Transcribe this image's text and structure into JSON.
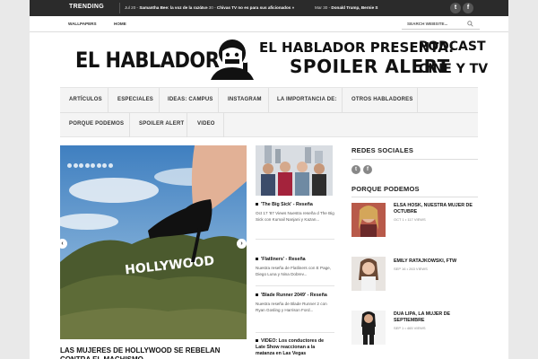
{
  "topbar": {
    "trending_label": "TRENDING",
    "items": [
      {
        "date": "Jul 20 -",
        "title": "Samantha Bee: la voz de la razón »"
      },
      {
        "date": "Jun 30 -",
        "title": "Chivas TV no es para sus aficionados »"
      },
      {
        "date": "Mar 30 -",
        "title": "Donald Trump, Bernie S"
      }
    ],
    "social": [
      {
        "icon": "twitter-icon",
        "glyph": "t"
      },
      {
        "icon": "facebook-icon",
        "glyph": "f"
      }
    ]
  },
  "subbar": {
    "links": [
      "WALLPAPERS",
      "HOME"
    ],
    "search_placeholder": "SEARCH WEBSITE..."
  },
  "logo": "EL HABLADOR",
  "banner": {
    "line1": "EL HABLADOR PRESENTA:",
    "line2": "SPOILER ALERT",
    "right1": "PODCAST",
    "right2": "CINE Y TV"
  },
  "nav": {
    "row1": [
      "ARTÍCULOS",
      "ESPECIALES",
      "IDEAS: CAMPUS",
      "INSTAGRAM",
      "LA IMPORTANCIA DE:",
      "OTROS HABLADORES"
    ],
    "row2": [
      "PORQUE PODEMOS",
      "SPOILER ALERT",
      "VIDEO"
    ]
  },
  "slider": {
    "dot_count": 8,
    "hollywood_sign": "HOLLYWOOD",
    "title": "LAS MUJERES DE HOLLYWOOD SE REBELAN CONTRA EL MACHISMO"
  },
  "middle": {
    "items": [
      {
        "title": "'The Big Sick' - Reseña",
        "excerpt": "Oct 17 '87 Views Nuestra reseña d The Big Sick con Kumail Nanjani y Kazan..."
      },
      {
        "title": "'Flatliners' - Reseña",
        "excerpt": "Nuestra reseña de Flatliners con E Page, Diego Luna y Nina Dobrev..."
      },
      {
        "title": "'Blade Runner 2049' - Reseña",
        "excerpt": "Nuestra reseña de Blade Runner 2 con Ryan Gosling y Harrison Ford..."
      },
      {
        "title": "VIDEO: Los conductores de Late Show reaccionan a la matanza en Las Vegas",
        "excerpt": ""
      }
    ]
  },
  "sidebar": {
    "social_heading": "REDES SOCIALES",
    "section_heading": "PORQUE PODEMOS",
    "posts": [
      {
        "title": "ELSA HOSK, NUESTRA MUJER DE OCTUBRE",
        "meta": "OCT 1 • 117 VIEWS"
      },
      {
        "title": "EMILY RATAJKOWSKI, FTW",
        "meta": "SEP 16 • 263 VIEWS"
      },
      {
        "title": "DUA LIPA, LA MUJER DE SEPTIEMBRE",
        "meta": "SEP 1 • 465 VIEWS"
      }
    ]
  }
}
